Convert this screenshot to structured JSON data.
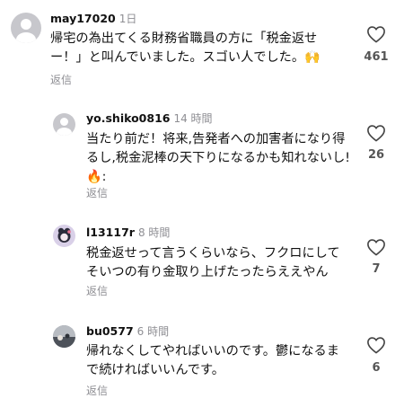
{
  "comments": [
    {
      "username": "may17020",
      "time": "1日",
      "text_lines": [
        "帰宅の為出てくる財務省職員の方に「税金返せ",
        "ー！」と叫んでいました。スゴい人でした。🙌"
      ],
      "reply": "返信",
      "likes": "461",
      "avatar": "default-avatar"
    },
    {
      "username": "yo.shiko0816",
      "time": "14 時間",
      "text_lines": [
        "当たり前だ！将来,告発者への加害者になり得",
        "るし,税金泥棒の天下りになるかも知れないし!",
        "🔥:"
      ],
      "reply": "返信",
      "likes": "26",
      "avatar": "default-avatar"
    },
    {
      "username": "l13117r",
      "time": "8 時間",
      "text_lines": [
        "税金返せって言うくらいなら、フクロにして",
        "そいつの有り金取り上げたったらええやん"
      ],
      "reply": "返信",
      "likes": "7",
      "avatar": "character-avatar"
    },
    {
      "username": "bu0577",
      "time": "6 時間",
      "text_lines": [
        "帰れなくしてやればいいのです。鬱になるま",
        "で続ければいいんです。"
      ],
      "reply": "返信",
      "likes": "6",
      "avatar": "photo-avatar"
    }
  ]
}
